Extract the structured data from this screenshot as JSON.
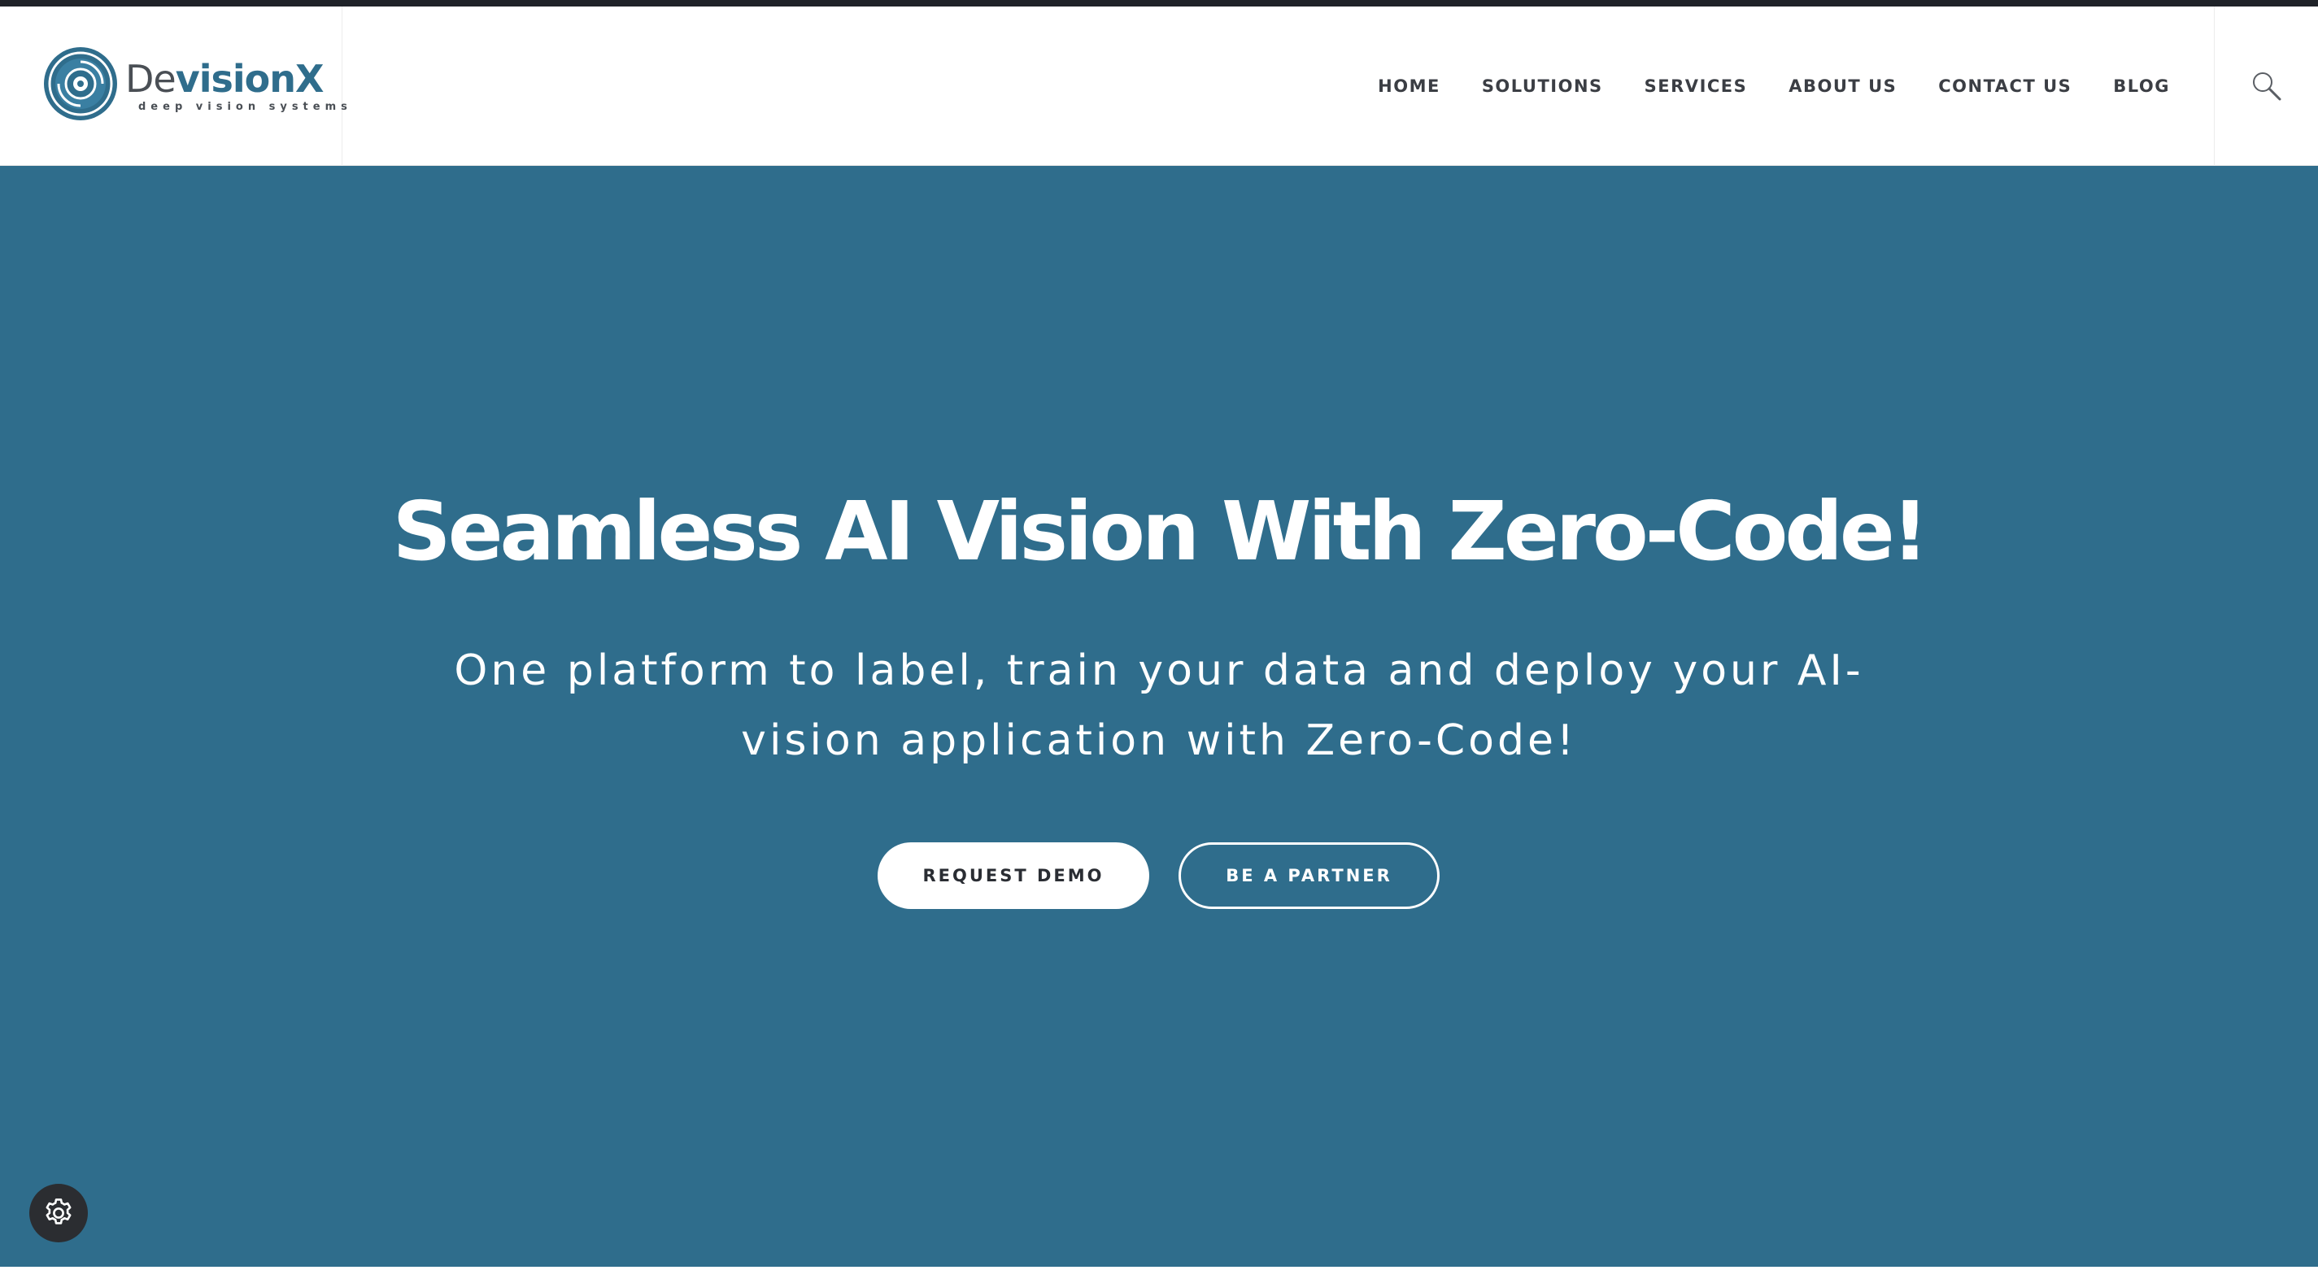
{
  "brand": {
    "name_prefix": "De",
    "name_rest": "visionX",
    "tagline": "deep vision systems",
    "brand_color": "#2f6d8c",
    "text_color": "#4a4f55"
  },
  "nav": {
    "items": [
      {
        "label": "HOME"
      },
      {
        "label": "SOLUTIONS"
      },
      {
        "label": "SERVICES"
      },
      {
        "label": "ABOUT US"
      },
      {
        "label": "CONTACT US"
      },
      {
        "label": "BLOG"
      }
    ],
    "search_icon": "search-icon"
  },
  "hero": {
    "title": "Seamless AI Vision With Zero-Code!",
    "subtitle": "One platform to label, train your data and deploy your AI-vision application with Zero-Code!",
    "background_color": "#2f6d8c",
    "buttons": {
      "request_demo": "REQUEST DEMO",
      "be_partner": "BE A PARTNER"
    }
  },
  "widget": {
    "icon": "gear-icon"
  }
}
